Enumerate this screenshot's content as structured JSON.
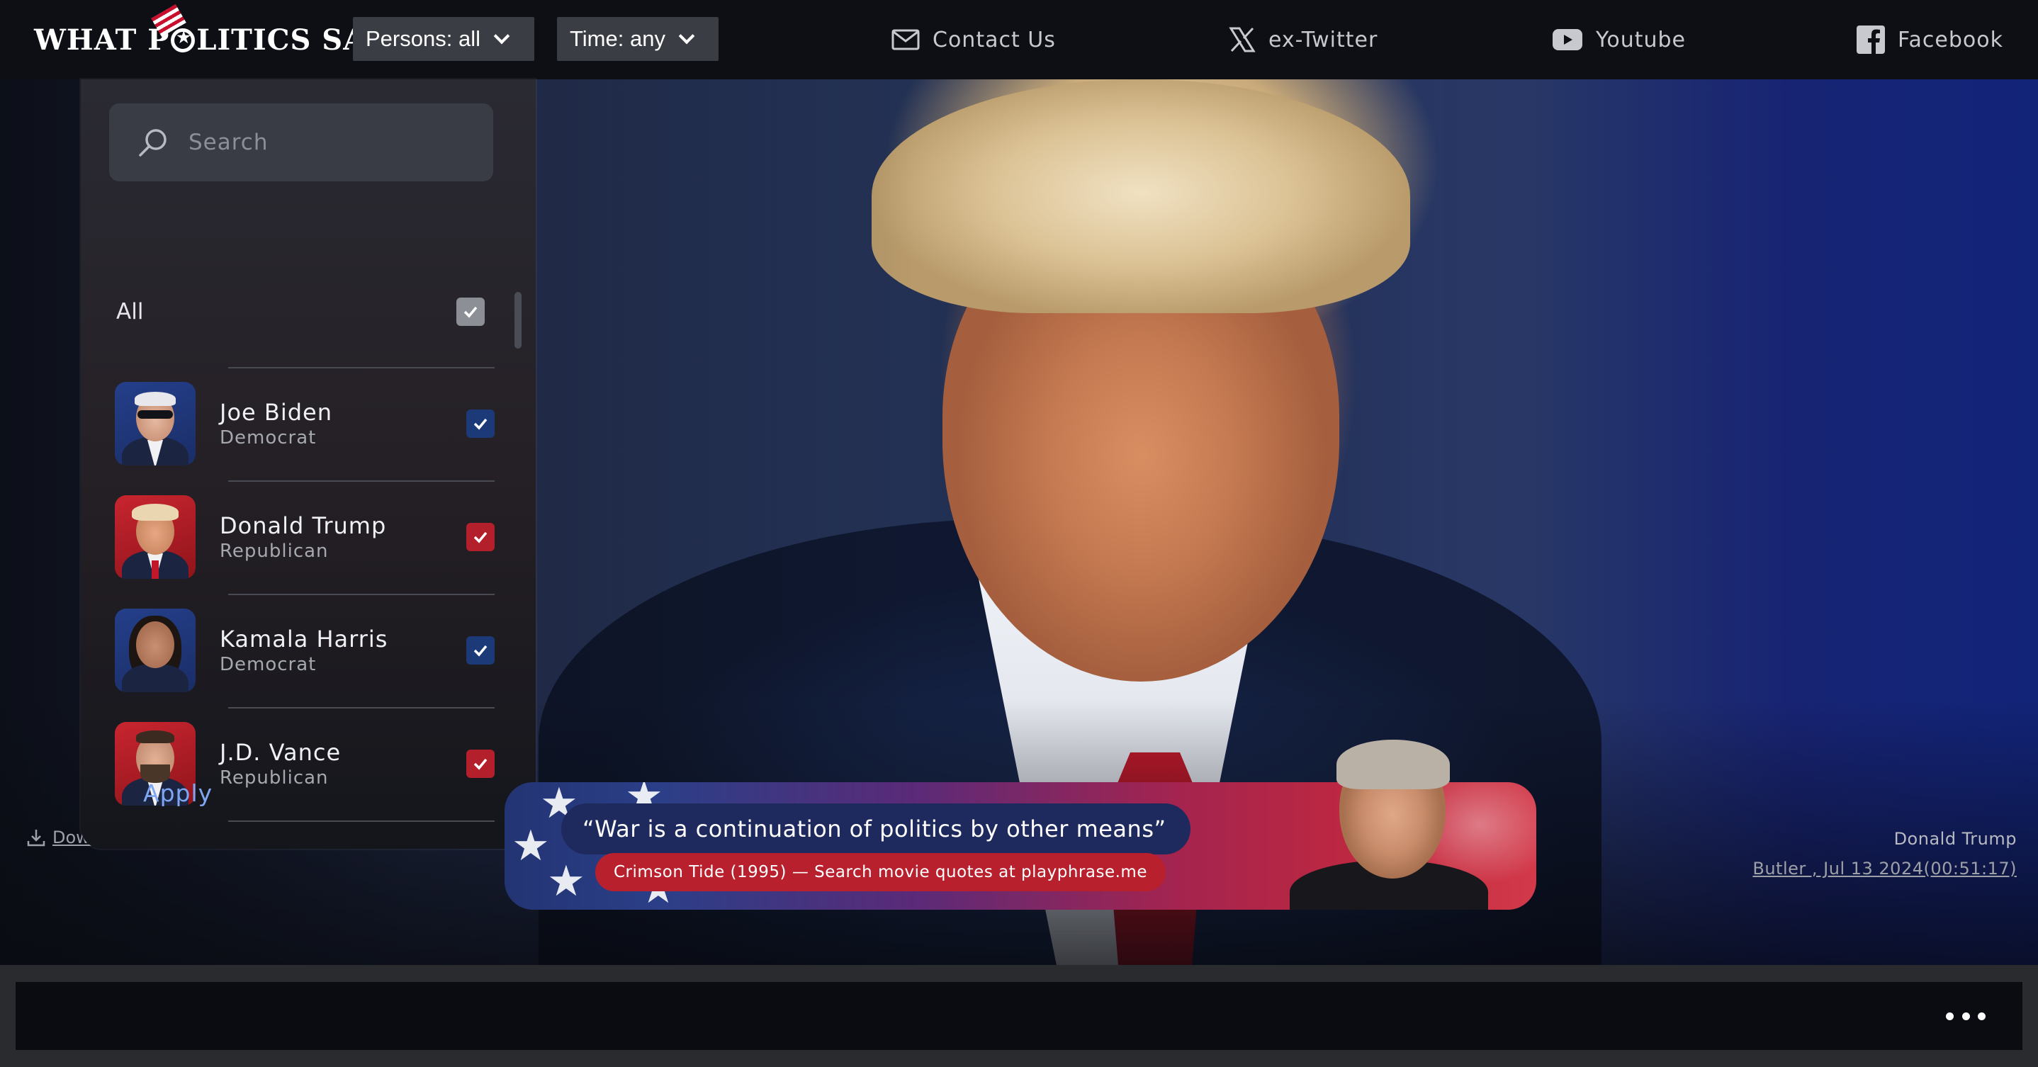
{
  "header": {
    "logo_text_1": "WHAT P",
    "logo_text_2": "LITICS SAY",
    "persons_dropdown": "Persons: all",
    "time_dropdown": "Time: any",
    "links": {
      "contact": "Contact Us",
      "twitter": "ex-Twitter",
      "youtube": "Youtube",
      "facebook": "Facebook"
    }
  },
  "panel": {
    "search_placeholder": "Search",
    "all_label": "All",
    "persons": [
      {
        "name": "Joe Biden",
        "party": "Democrat",
        "checked": true
      },
      {
        "name": "Donald Trump",
        "party": "Republican",
        "checked": true
      },
      {
        "name": "Kamala Harris",
        "party": "Democrat",
        "checked": true
      },
      {
        "name": "J.D. Vance",
        "party": "Republican",
        "checked": true
      }
    ],
    "apply_label": "Apply"
  },
  "faint": {
    "download": "Down"
  },
  "quote": {
    "text": "“War is a continuation of politics by other means”",
    "source": "Crimson Tide (1995) — Search movie quotes at playphrase.me"
  },
  "caption": {
    "speaker": "Donald Trump",
    "location": "Butler , Jul 13 2024(00:51:17)"
  },
  "colors": {
    "democrat": "#1d3a78",
    "republican": "#b3202c",
    "accent_link": "#7fa6f2"
  },
  "icons": [
    "search-icon",
    "mail-icon",
    "x-icon",
    "youtube-icon",
    "facebook-icon",
    "check-icon",
    "chevron-down-icon",
    "download-icon",
    "more-icon"
  ]
}
